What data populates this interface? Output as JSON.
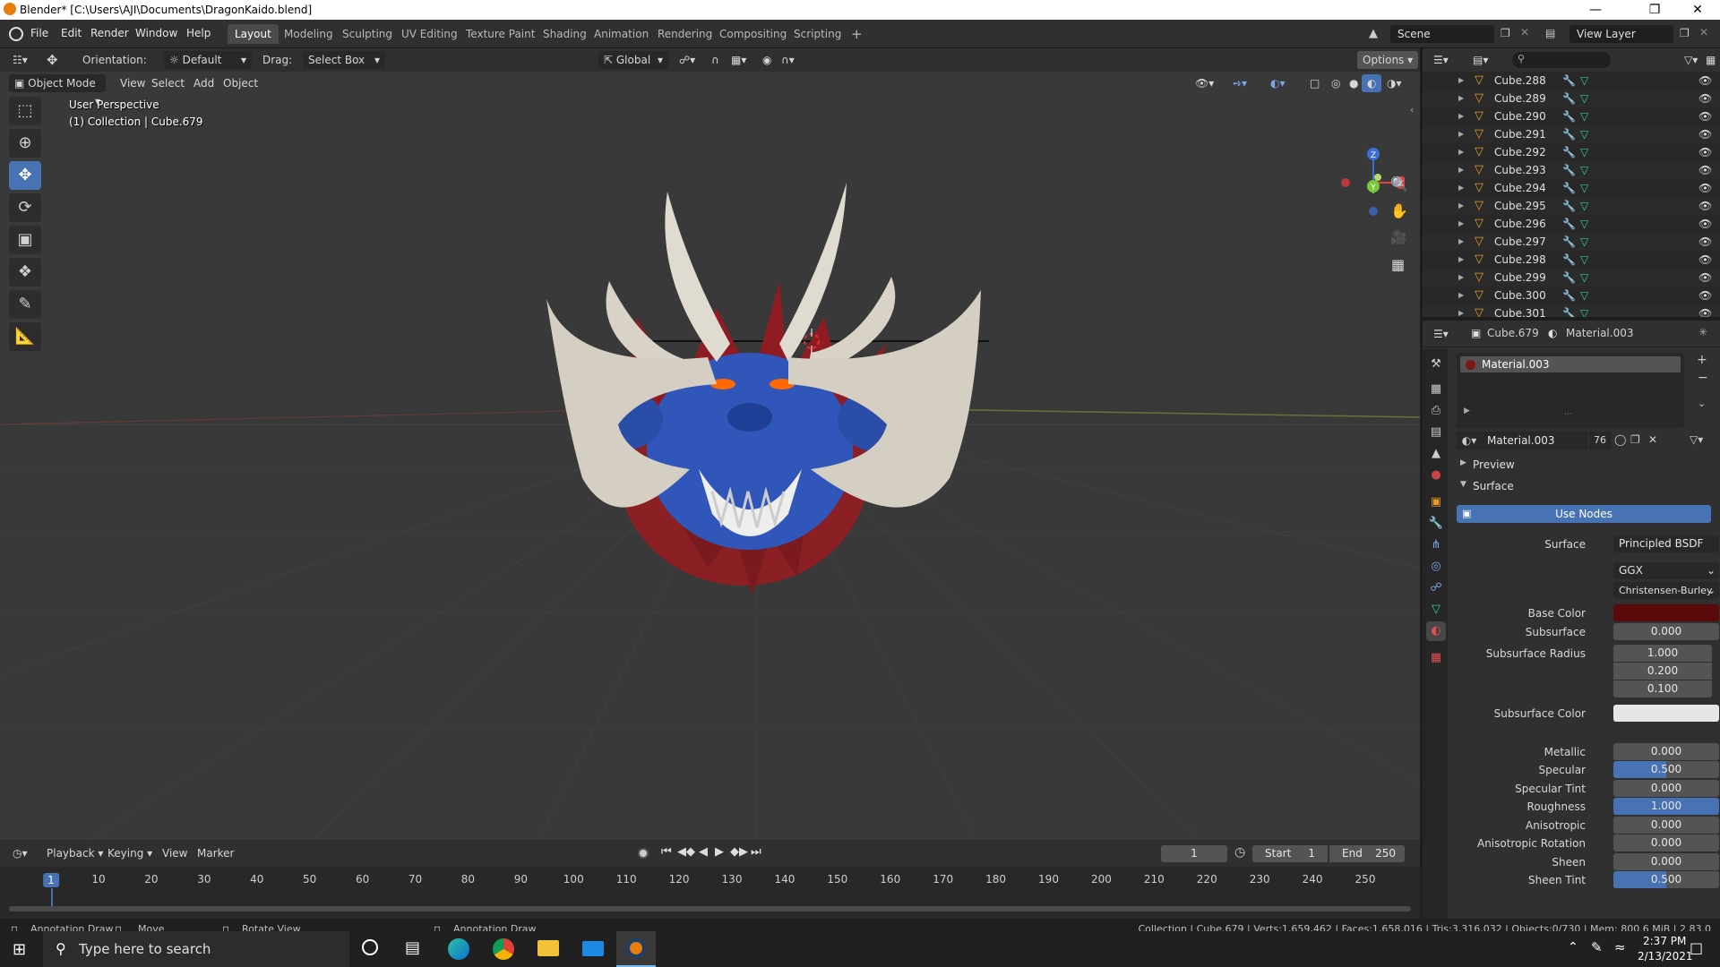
{
  "window": {
    "title": "Blender* [C:\\Users\\AJI\\Documents\\DragonKaido.blend]"
  },
  "menu": [
    "File",
    "Edit",
    "Render",
    "Window",
    "Help"
  ],
  "workspaces": [
    "Layout",
    "Modeling",
    "Sculpting",
    "UV Editing",
    "Texture Paint",
    "Shading",
    "Animation",
    "Rendering",
    "Compositing",
    "Scripting"
  ],
  "workspace_add": "+",
  "scene": {
    "label": "Scene",
    "view_layer": "View Layer"
  },
  "viewport": {
    "orientation_label": "Orientation:",
    "orientation_value": "Default",
    "drag_label": "Drag:",
    "drag_value": "Select Box",
    "transform_orientation": "Global",
    "options": "Options",
    "mode": "Object Mode",
    "header_menus": [
      "View",
      "Select",
      "Add",
      "Object"
    ],
    "overlay_line1": "User Perspective",
    "overlay_line2": "(1) Collection | Cube.679",
    "gizmo": {
      "x": "X",
      "y": "Y",
      "z": "Z"
    }
  },
  "outliner": {
    "items": [
      "Cube.288",
      "Cube.289",
      "Cube.290",
      "Cube.291",
      "Cube.292",
      "Cube.293",
      "Cube.294",
      "Cube.295",
      "Cube.296",
      "Cube.297",
      "Cube.298",
      "Cube.299",
      "Cube.300",
      "Cube.301"
    ]
  },
  "properties": {
    "object_name": "Cube.679",
    "material_name": "Material.003",
    "slot_name": "Material.003",
    "material_field": "Material.003",
    "user_count": "76",
    "panels": {
      "preview": "Preview",
      "surface": "Surface"
    },
    "use_nodes": "Use Nodes",
    "surface_label": "Surface",
    "surface_value": "Principled BSDF",
    "distribution": "GGX",
    "subsurface_method": "Christensen-Burley",
    "base_color_label": "Base Color",
    "base_color": "#5a0a0a",
    "subsurface_radius_label": "Subsurface Radius",
    "subsurface_radius": [
      "1.000",
      "0.200",
      "0.100"
    ],
    "subsurface_color_label": "Subsurface Color",
    "subsurface_color": "#e6e6e6",
    "fields": [
      {
        "label": "Subsurface",
        "value": "0.000"
      },
      {
        "label": "Metallic",
        "value": "0.000"
      },
      {
        "label": "Specular",
        "value": "0.500",
        "fill": 0.5
      },
      {
        "label": "Specular Tint",
        "value": "0.000"
      },
      {
        "label": "Roughness",
        "value": "1.000",
        "fill": 1.0
      },
      {
        "label": "Anisotropic",
        "value": "0.000"
      },
      {
        "label": "Anisotropic Rotation",
        "value": "0.000"
      },
      {
        "label": "Sheen",
        "value": "0.000"
      },
      {
        "label": "Sheen Tint",
        "value": "0.500",
        "fill": 0.5
      }
    ]
  },
  "timeline": {
    "menus": [
      "Playback",
      "Keying",
      "View",
      "Marker"
    ],
    "current_frame": "1",
    "start_label": "Start",
    "start": "1",
    "end_label": "End",
    "end": "250",
    "ticks": [
      "1",
      "10",
      "20",
      "30",
      "40",
      "50",
      "60",
      "70",
      "80",
      "90",
      "100",
      "110",
      "120",
      "130",
      "140",
      "150",
      "160",
      "170",
      "180",
      "190",
      "200",
      "210",
      "220",
      "230",
      "240",
      "250"
    ]
  },
  "statusbar": {
    "left": [
      "Annotation Draw",
      "Move",
      "Rotate View",
      "Annotation Draw"
    ],
    "right": "Collection | Cube.679 | Verts:1,659,462 | Faces:1,658,016 | Tris:3,316,032 | Objects:0/730 | Mem: 800.6 MiB | 2.83.0"
  },
  "taskbar": {
    "search_placeholder": "Type here to search",
    "time": "2:37 PM",
    "date": "2/13/2021"
  }
}
